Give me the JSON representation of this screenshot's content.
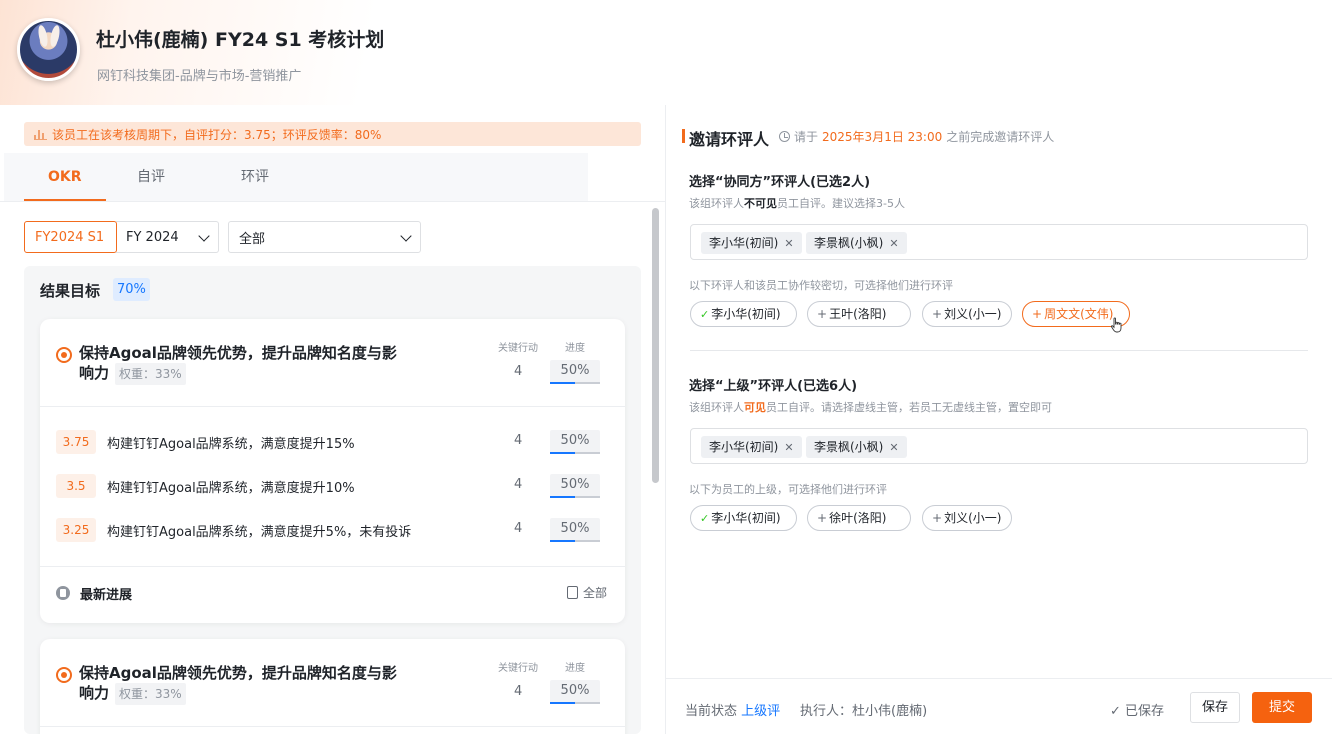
{
  "header": {
    "title": "杜小伟(鹿楠) FY24 S1 考核计划",
    "subtitle": "网钉科技集团-品牌与市场-营销推广"
  },
  "notice": "该员工在该考核周期下，自评打分：3.75；环评反馈率：80%",
  "tabs": [
    "OKR",
    "自评",
    "环评"
  ],
  "filters": {
    "period": "FY2024 S1",
    "year": "FY 2024",
    "scope": "全部"
  },
  "result": {
    "title": "结果目标",
    "percent": "70%"
  },
  "column_headers": {
    "actions": "关键行动",
    "progress": "进度"
  },
  "objectives": [
    {
      "title": "保持Agoal品牌领先优势，提升品牌知名度与影响力",
      "weight": "权重：33%",
      "actions": "4",
      "progress_text": "50%",
      "progress": 0.5,
      "key_results": [
        {
          "score": "3.75",
          "text": "构建钉钉Agoal品牌系统，满意度提升15%",
          "actions": "4",
          "progress_text": "50%",
          "progress": 0.5
        },
        {
          "score": "3.5",
          "text": "构建钉钉Agoal品牌系统，满意度提升10%",
          "actions": "4",
          "progress_text": "50%",
          "progress": 0.5
        },
        {
          "score": "3.25",
          "text": "构建钉钉Agoal品牌系统，满意度提升5%，未有投诉",
          "actions": "4",
          "progress_text": "50%",
          "progress": 0.5
        }
      ],
      "latest_title": "最新进展",
      "latest_all": "全部"
    },
    {
      "title": "保持Agoal品牌领先优势，提升品牌知名度与影响力",
      "weight": "权重：33%",
      "actions": "4",
      "progress_text": "50%",
      "progress": 0.5
    }
  ],
  "invite": {
    "title": "邀请环评人",
    "deadline_prefix": "请于",
    "deadline_date": "2025年3月1日 23:00",
    "deadline_suffix": "之前完成邀请环评人"
  },
  "peer": {
    "title": "选择“协同方”环评人(已选2人)",
    "hint_a": "该组环评人",
    "hint_b": "不可见",
    "hint_c": "员工自评。建议选择3-5人",
    "selected": [
      "李小华(初间)",
      "李景枫(小枫)"
    ],
    "suggest_hint": "以下环评人和该员工协作较密切，可选择他们进行环评",
    "suggestions": [
      {
        "label": "李小华(初间)",
        "mark": "✓"
      },
      {
        "label": "王叶(洛阳)",
        "mark": "+"
      },
      {
        "label": "刘义(小一)",
        "mark": "+"
      },
      {
        "label": "周文文(文伟)",
        "mark": "+"
      }
    ]
  },
  "superior": {
    "title": "选择“上级”环评人(已选6人)",
    "hint_a": "该组环评人",
    "hint_b": "可见",
    "hint_c": "员工自评。请选择虚线主管，若员工无虚线主管，置空即可",
    "selected": [
      "李小华(初间)",
      "李景枫(小枫)"
    ],
    "suggest_hint": "以下为员工的上级，可选择他们进行环评",
    "suggestions": [
      {
        "label": "李小华(初间)",
        "mark": "✓"
      },
      {
        "label": "徐叶(洛阳)",
        "mark": "+"
      },
      {
        "label": "刘义(小一)",
        "mark": "+"
      }
    ]
  },
  "footer": {
    "status_label": "当前状态",
    "status_value": "上级评",
    "executor": "执行人：杜小伟(鹿楠)",
    "saved": "已保存",
    "save": "保存",
    "submit": "提交"
  },
  "colors": {
    "accent": "#f26b1d",
    "blue": "#1677ff",
    "check": "#34c724"
  }
}
